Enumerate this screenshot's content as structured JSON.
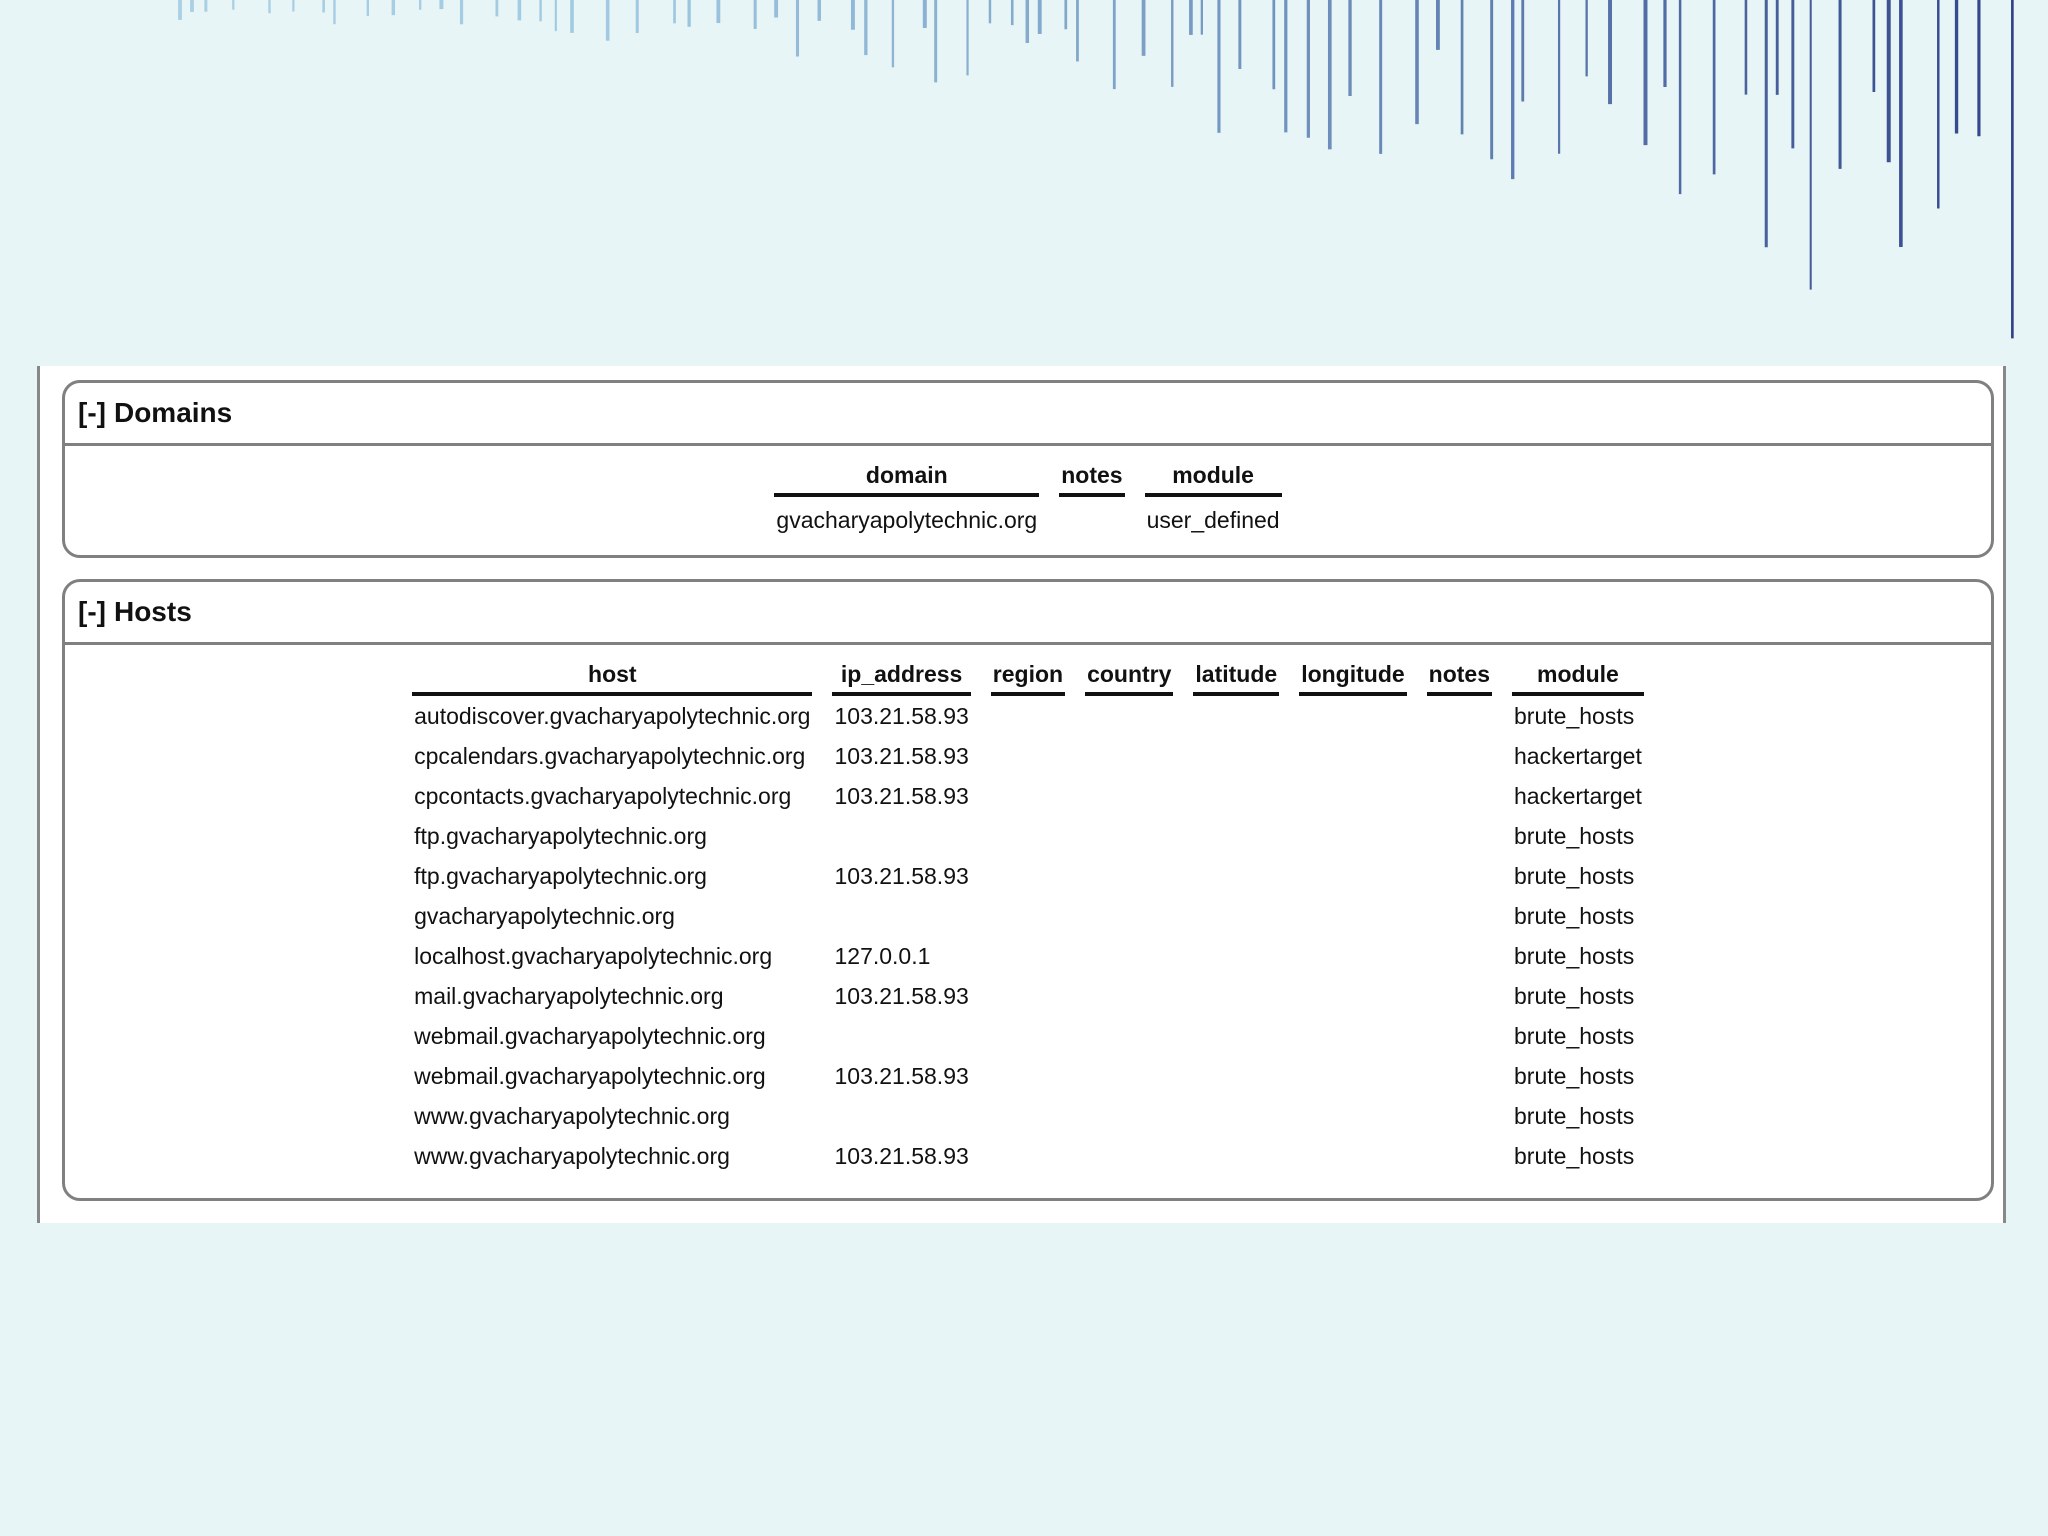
{
  "domains": {
    "toggle": "[-]",
    "title": "Domains",
    "columns": [
      "domain",
      "notes",
      "module"
    ],
    "rows": [
      [
        "gvacharyapolytechnic.org",
        "",
        "user_defined"
      ]
    ]
  },
  "hosts": {
    "toggle": "[-]",
    "title": "Hosts",
    "columns": [
      "host",
      "ip_address",
      "region",
      "country",
      "latitude",
      "longitude",
      "notes",
      "module"
    ],
    "rows": [
      [
        "autodiscover.gvacharyapolytechnic.org",
        "103.21.58.93",
        "",
        "",
        "",
        "",
        "",
        "brute_hosts"
      ],
      [
        "cpcalendars.gvacharyapolytechnic.org",
        "103.21.58.93",
        "",
        "",
        "",
        "",
        "",
        "hackertarget"
      ],
      [
        "cpcontacts.gvacharyapolytechnic.org",
        "103.21.58.93",
        "",
        "",
        "",
        "",
        "",
        "hackertarget"
      ],
      [
        "ftp.gvacharyapolytechnic.org",
        "",
        "",
        "",
        "",
        "",
        "",
        "brute_hosts"
      ],
      [
        "ftp.gvacharyapolytechnic.org",
        "103.21.58.93",
        "",
        "",
        "",
        "",
        "",
        "brute_hosts"
      ],
      [
        "gvacharyapolytechnic.org",
        "",
        "",
        "",
        "",
        "",
        "",
        "brute_hosts"
      ],
      [
        "localhost.gvacharyapolytechnic.org",
        "127.0.0.1",
        "",
        "",
        "",
        "",
        "",
        "brute_hosts"
      ],
      [
        "mail.gvacharyapolytechnic.org",
        "103.21.58.93",
        "",
        "",
        "",
        "",
        "",
        "brute_hosts"
      ],
      [
        "webmail.gvacharyapolytechnic.org",
        "",
        "",
        "",
        "",
        "",
        "",
        "brute_hosts"
      ],
      [
        "webmail.gvacharyapolytechnic.org",
        "103.21.58.93",
        "",
        "",
        "",
        "",
        "",
        "brute_hosts"
      ],
      [
        "www.gvacharyapolytechnic.org",
        "",
        "",
        "",
        "",
        "",
        "",
        "brute_hosts"
      ],
      [
        "www.gvacharyapolytechnic.org",
        "103.21.58.93",
        "",
        "",
        "",
        "",
        "",
        "brute_hosts"
      ]
    ]
  },
  "colors": {
    "background": "#e8f5f6",
    "panel": "#ffffff",
    "border": "#808080",
    "banner_light": "#7fb6d9",
    "banner_dark": "#2c3f86"
  }
}
